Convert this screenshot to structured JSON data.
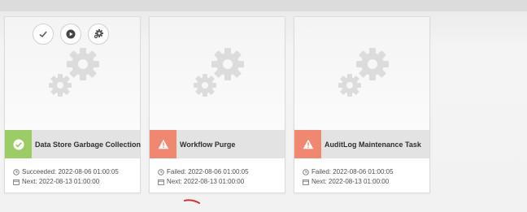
{
  "colors": {
    "success": "#9ccc65",
    "failed": "#f08770",
    "titlebar": "#e3e3e3",
    "gear": "#dcdcdc"
  },
  "quick_actions": [
    {
      "icon": "checkmark-icon"
    },
    {
      "icon": "play-icon"
    },
    {
      "icon": "gear-icon"
    }
  ],
  "tasks": [
    {
      "status": "success",
      "status_icon": "check-circle-icon",
      "title": "Data Store Garbage Collection",
      "last_run": "Succeeded: 2022-08-06 01:00:05",
      "next_run": "Next: 2022-08-13 01:00:00"
    },
    {
      "status": "failed",
      "status_icon": "warning-icon",
      "title": "Workflow Purge",
      "last_run": "Failed: 2022-08-06 01:00:05",
      "next_run": "Next: 2022-08-13 01:00:00"
    },
    {
      "status": "failed",
      "status_icon": "warning-icon",
      "title": "AuditLog Maintenance Task",
      "last_run": "Failed: 2022-08-06 01:00:05",
      "next_run": "Next: 2022-08-13 01:00:00"
    }
  ]
}
